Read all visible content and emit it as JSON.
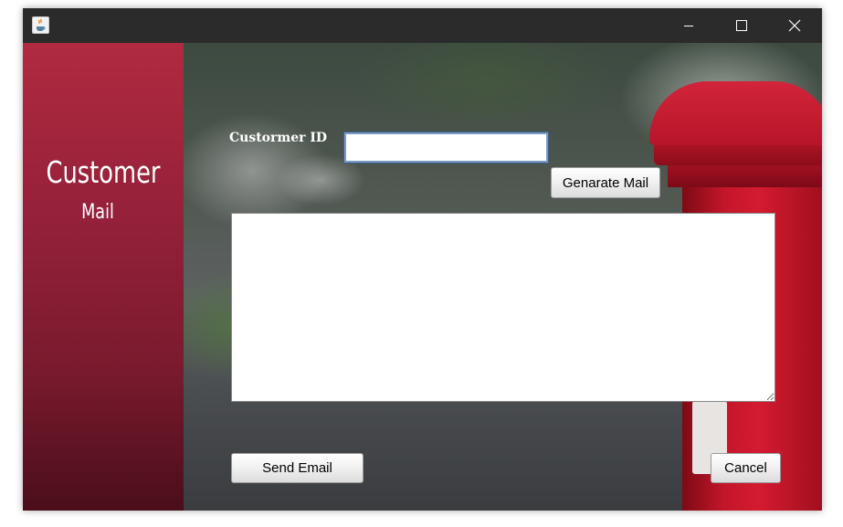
{
  "window": {
    "title": "",
    "app_icon": "java-coffee-icon",
    "controls": {
      "minimize_icon": "minimize-icon",
      "maximize_icon": "maximize-icon",
      "close_icon": "close-icon"
    }
  },
  "sidebar": {
    "title": "Customer",
    "subtitle": "Mail",
    "accent_color": "#96213a"
  },
  "form": {
    "customer_id_label": "Custormer ID",
    "customer_id_value": "",
    "generate_button": "Genarate Mail",
    "mail_body_value": "",
    "send_button": "Send Email",
    "cancel_button": "Cancel"
  },
  "background": {
    "description_color": "#c3162a"
  }
}
